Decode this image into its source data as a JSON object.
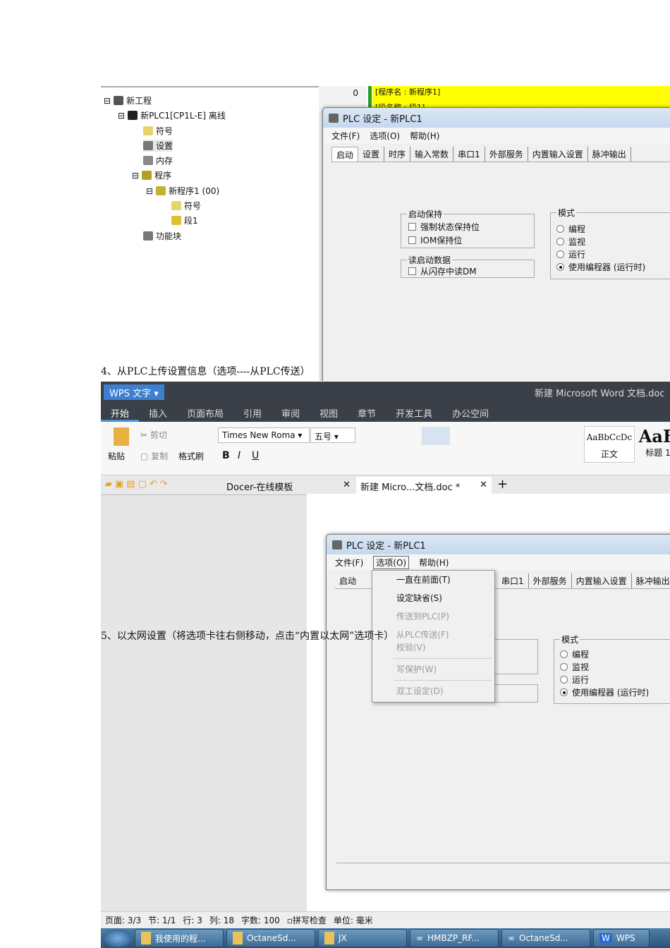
{
  "screenshot1": {
    "tree": [
      "新工程",
      "新PLC1[CP1L-E] 离线",
      "符号",
      "设置",
      "内存",
      "程序",
      "新程序1 (00)",
      "符号",
      "段1",
      "功能块"
    ],
    "ladder": {
      "row": "0",
      "program_name": "[程序名 : 新程序1]",
      "section_name": "[段名称 : 段1]"
    },
    "dialog": {
      "title": "PLC 设定 - 新PLC1",
      "menu": [
        "文件(F)",
        "选项(O)",
        "帮助(H)"
      ],
      "tabs": [
        "启动",
        "设置",
        "时序",
        "输入常数",
        "串口1",
        "外部服务",
        "内置输入设置",
        "脉冲输出"
      ],
      "startup_hold": {
        "legend": "启动保持",
        "items": [
          "强制状态保持位",
          "IOM保持位"
        ]
      },
      "read_startup": {
        "legend": "读启动数据",
        "items": [
          "从闪存中读DM"
        ]
      },
      "mode": {
        "legend": "模式",
        "options": [
          "编程",
          "监视",
          "运行",
          "使用编程器 (运行时)"
        ],
        "selected": 3
      }
    }
  },
  "caption4": "4、从PLC上传设置信息（选项----从PLC传送）",
  "caption5": "5、以太网设置（将选项卡往右侧移动，点击“内置以太网”选项卡）",
  "wps": {
    "app": "WPS 文字",
    "doc_title": "新建 Microsoft Word 文档.doc",
    "ribbon_tabs": [
      "开始",
      "插入",
      "页面布局",
      "引用",
      "审阅",
      "视图",
      "章节",
      "开发工具",
      "办公空间"
    ],
    "toolbar": {
      "paste": "粘贴",
      "cut": "剪切",
      "copy": "复制",
      "format_painter": "格式刷",
      "font": "Times New Roma",
      "size": "五号",
      "bold": "B",
      "italic": "I",
      "underline": "U",
      "style_normal": "正文",
      "style_heading": "标题 1",
      "style_sample": "AaBbCcDc",
      "style_sample2": "AaB"
    },
    "doc_tabs": [
      "Docer-在线模板",
      "新建 Micro...文档.doc *"
    ],
    "dialog": {
      "title": "PLC 设定 - 新PLC1",
      "menu": [
        "文件(F)",
        "选项(O)",
        "帮助(H)"
      ],
      "tabs": [
        "启动",
        "串口1",
        "外部服务",
        "内置输入设置",
        "脉冲输出"
      ],
      "dropdown": [
        {
          "label": "一直在前面(T)",
          "enabled": true
        },
        {
          "label": "设定缺省(S)",
          "enabled": true
        },
        {
          "label": "传送到PLC(P)",
          "enabled": false
        },
        {
          "label": "从PLC传送(F)",
          "enabled": false
        },
        {
          "label": "校验(V)",
          "enabled": false
        },
        {
          "label": "写保护(W)",
          "enabled": false
        },
        {
          "label": "双工设定(D)",
          "enabled": false
        }
      ],
      "mode": {
        "legend": "模式",
        "options": [
          "编程",
          "监视",
          "运行",
          "使用编程器 (运行时)"
        ],
        "selected": 3
      }
    },
    "status": [
      "页面: 3/3",
      "节: 1/1",
      "行: 3",
      "列: 18",
      "字数: 100",
      "拼写检查",
      "单位: 毫米"
    ],
    "taskbar": [
      "我使用的程...",
      "OctaneSd...",
      "JX",
      "HMBZP_RF...",
      "OctaneSd...",
      "WPS"
    ]
  }
}
